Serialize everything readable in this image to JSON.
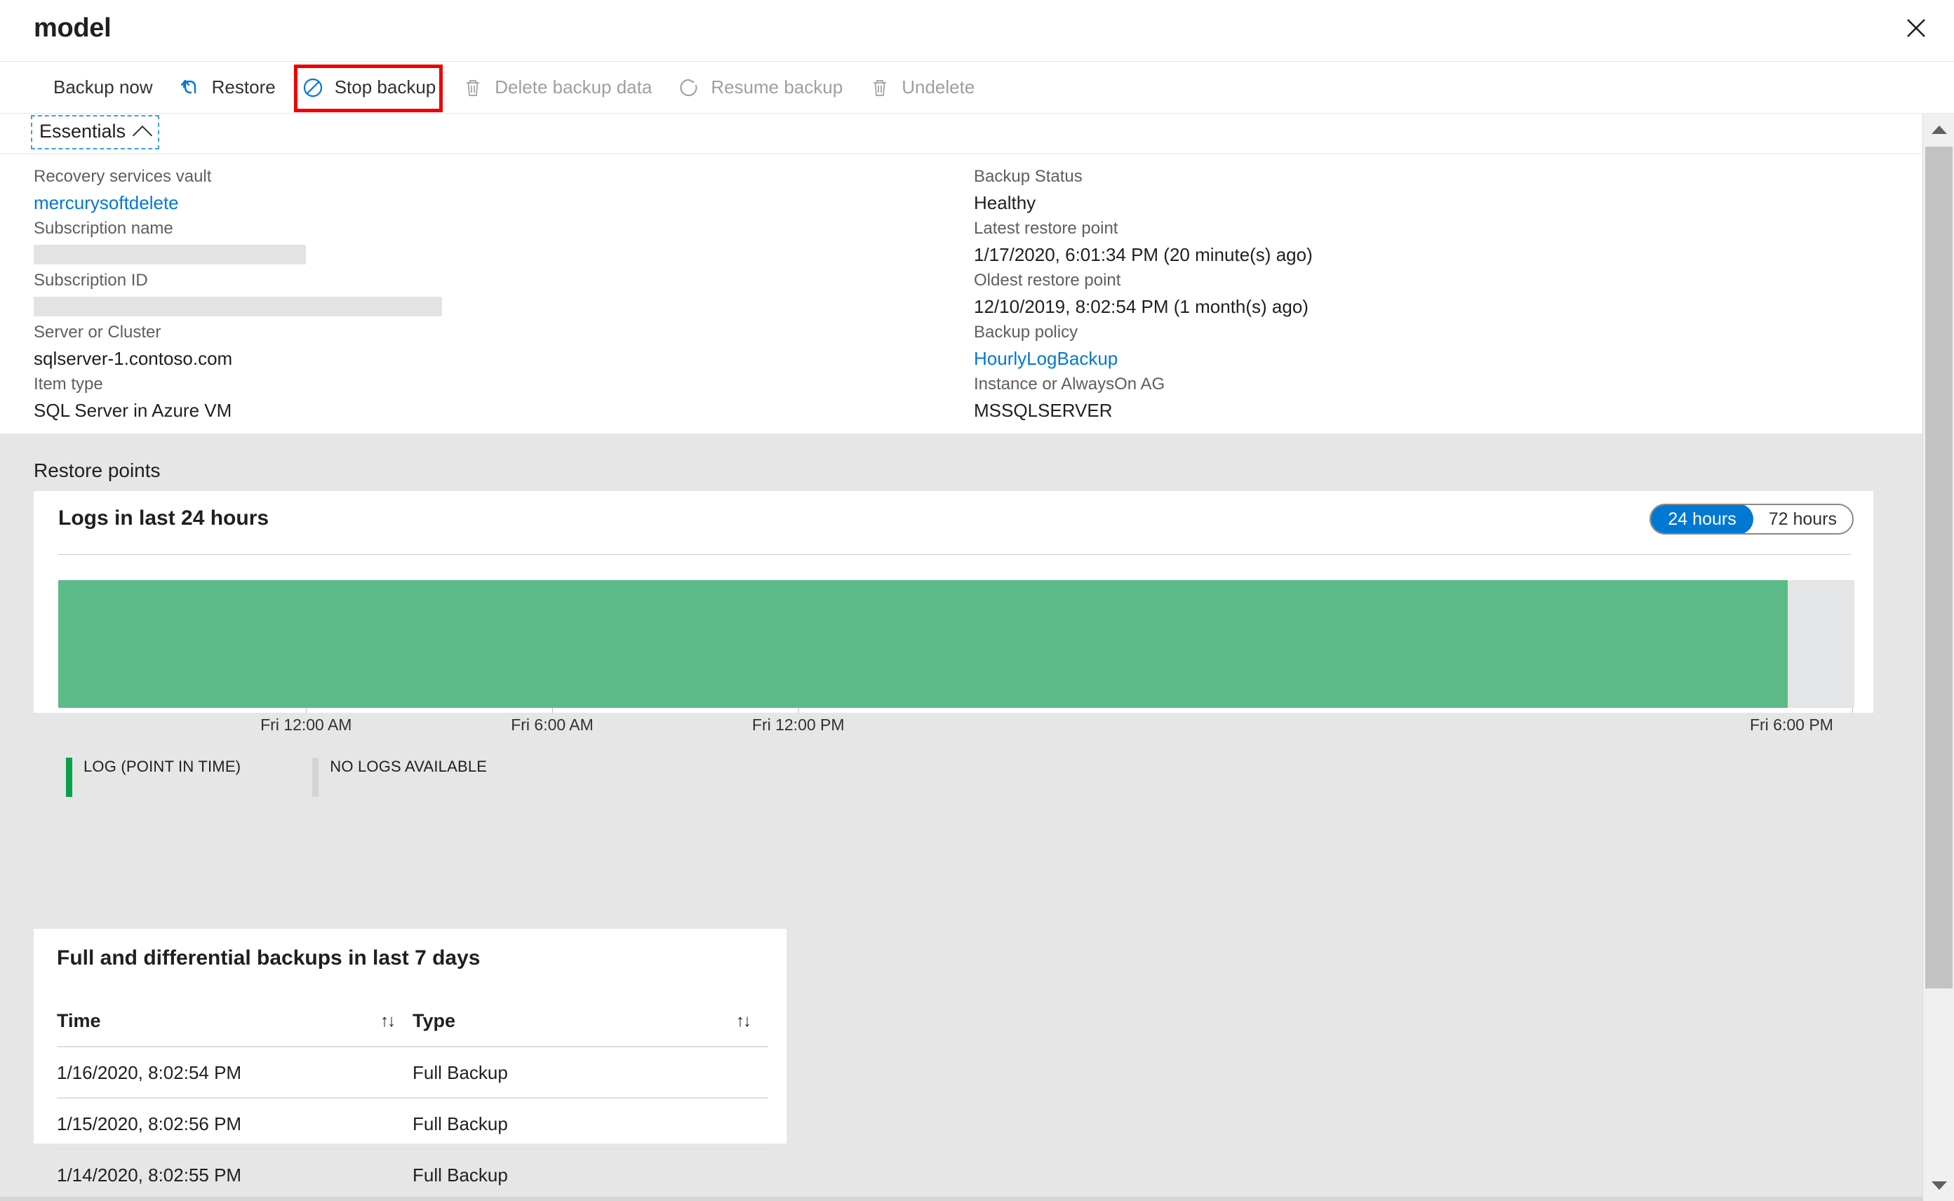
{
  "blade": {
    "title": "model",
    "close_icon": "close-icon"
  },
  "commandbar": {
    "items": [
      {
        "label": "Backup now",
        "icon": "",
        "enabled": true
      },
      {
        "label": "Restore",
        "icon": "undo-icon",
        "enabled": true
      },
      {
        "label": "Stop backup",
        "icon": "block-icon",
        "enabled": true
      },
      {
        "label": "Delete backup data",
        "icon": "trash-icon",
        "enabled": false
      },
      {
        "label": "Resume backup",
        "icon": "refresh-icon",
        "enabled": false
      },
      {
        "label": "Undelete",
        "icon": "trash-icon",
        "enabled": false
      }
    ],
    "highlighted": "Stop backup",
    "highlight_color": "#ee0000"
  },
  "essentials": {
    "toggle_label": "Essentials",
    "chevron_icon": "chevron-up-icon",
    "left": [
      {
        "label": "Recovery services vault",
        "value": "mercurysoftdelete",
        "link": true
      },
      {
        "label": "Subscription name",
        "value": "",
        "redacted": true
      },
      {
        "label": "Subscription ID",
        "value": "",
        "redacted": true
      },
      {
        "label": "Server or Cluster",
        "value": "sqlserver-1.contoso.com",
        "link": false
      },
      {
        "label": "Item type",
        "value": "SQL Server in Azure VM",
        "link": false
      }
    ],
    "right": [
      {
        "label": "Backup Status",
        "value": "Healthy",
        "link": false
      },
      {
        "label": "Latest restore point",
        "value": "1/17/2020, 6:01:34 PM (20 minute(s) ago)",
        "link": false
      },
      {
        "label": "Oldest restore point",
        "value": "12/10/2019, 8:02:54 PM (1 month(s) ago)",
        "link": false
      },
      {
        "label": "Backup policy",
        "value": "HourlyLogBackup",
        "link": true
      },
      {
        "label": "Instance or AlwaysOn AG",
        "value": "MSSQLSERVER",
        "link": false
      }
    ]
  },
  "restore_points": {
    "section_title": "Restore points"
  },
  "chart_card": {
    "title": "Logs in last 24 hours",
    "range_options": [
      {
        "label": "24 hours",
        "selected": true
      },
      {
        "label": "72 hours",
        "selected": false
      }
    ],
    "legend": [
      {
        "label": "LOG (POINT IN TIME)",
        "color": "#08a14b"
      },
      {
        "label": "NO LOGS AVAILABLE",
        "color": "#d4d4d4"
      }
    ]
  },
  "chart_data": {
    "type": "bar",
    "title": "Logs in last 24 hours",
    "xlabel": "",
    "ylabel": "",
    "grid": false,
    "legend_position": "bottom-left",
    "x_tick_labels": [
      "Fri 12:00 AM",
      "Fri 6:00 AM",
      "Fri 12:00 PM",
      "Fri 6:00 PM"
    ],
    "x_tick_positions_pct": [
      13.8,
      27.5,
      41.2,
      100.0
    ],
    "axis_range": [
      "Fri 12:00 AM",
      "Fri 6:00 PM"
    ],
    "series": [
      {
        "name": "LOG (POINT IN TIME)",
        "color": "#5bba87",
        "segments": [
          {
            "start_pct": 0.0,
            "end_pct": 96.3,
            "value": 1
          }
        ]
      },
      {
        "name": "NO LOGS AVAILABLE",
        "color": "#e4e5e7",
        "segments": [
          {
            "start_pct": 96.3,
            "end_pct": 100.0,
            "value": 0
          }
        ]
      }
    ]
  },
  "table_card": {
    "title": "Full and differential backups in last 7 days",
    "columns": [
      {
        "label": "Time",
        "sort_icon": "sort-icon"
      },
      {
        "label": "Type",
        "sort_icon": "sort-icon"
      }
    ],
    "sort_glyph": "↑↓",
    "rows": [
      {
        "time": "1/16/2020, 8:02:54 PM",
        "type": "Full Backup"
      },
      {
        "time": "1/15/2020, 8:02:56 PM",
        "type": "Full Backup"
      },
      {
        "time": "1/14/2020, 8:02:55 PM",
        "type": "Full Backup"
      }
    ]
  },
  "scrollbars": {
    "vertical": {
      "up_icon": "caret-up-icon",
      "down_icon": "caret-down-icon"
    },
    "horizontal": {}
  },
  "colors": {
    "accent": "#0078d4",
    "link": "#0078d4",
    "log_green": "#5bba87",
    "legend_green": "#08a14b",
    "no_logs_gray": "#e4e5e7",
    "highlight_red": "#ee0000",
    "page_bg": "#e6e6e6"
  }
}
